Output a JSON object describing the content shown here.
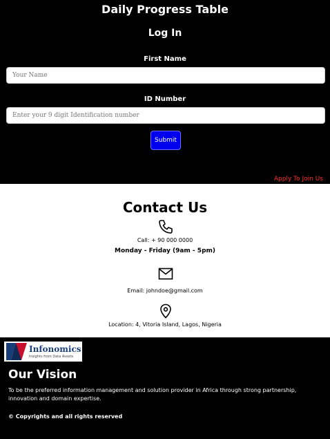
{
  "header": {
    "title": "Daily Progress Table"
  },
  "login": {
    "heading": "Log In",
    "first_name_label": "First Name",
    "first_name_placeholder": "Your Name",
    "first_name_value": "",
    "id_label": "ID Number",
    "id_placeholder": "Enter your 9 digit Identification number",
    "id_value": "",
    "submit_label": "Submit",
    "apply_link": "Apply To Join Us"
  },
  "contact": {
    "heading": "Contact Us",
    "phone": "Call: + 90 000 0000",
    "hours": "Monday - Friday (9am - 5pm)",
    "email": "Email: johndoe@gmail.com",
    "location": "Location: 4, Vitoria Island, Lagos, Nigeria",
    "icons": [
      "phone-icon",
      "mail-icon",
      "location-pin-icon"
    ]
  },
  "footer": {
    "logo_name": "Infonomics",
    "logo_tagline": "Insights from Data Assets",
    "vision_heading": "Our Vision",
    "vision_text": "To be the preferred information management and solution provider in Africa through strong partnership, innovation and domain expertise.",
    "copyright": "© Copyrights and all rights reserved"
  },
  "colors": {
    "page_bg": "#000000",
    "contact_bg": "#ffffff",
    "submit_bg": "#0000ee",
    "apply_link": "#ff2a2a",
    "logo_navy": "#1a3e7a",
    "logo_red": "#c8102e"
  }
}
